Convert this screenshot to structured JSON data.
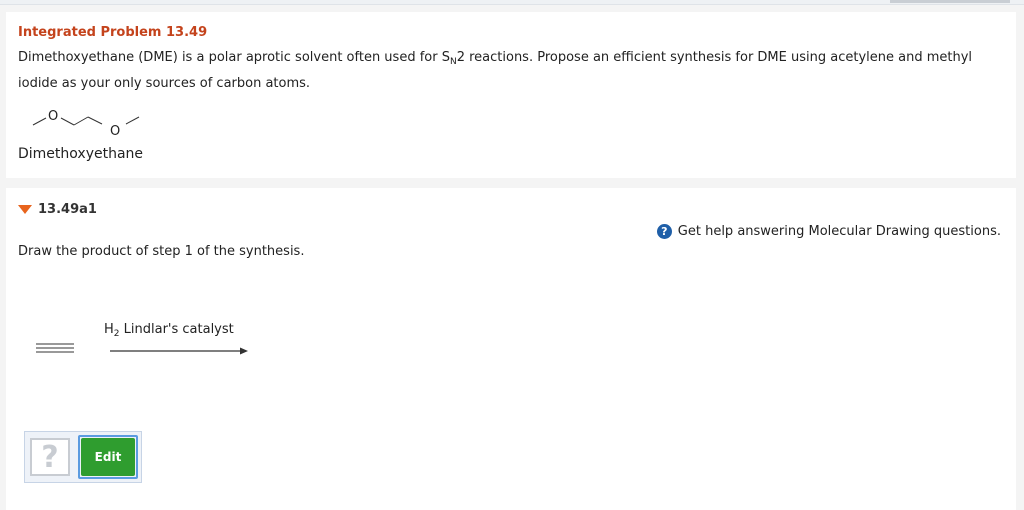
{
  "problem": {
    "title": "Integrated Problem 13.49",
    "text_before_sub": "Dimethoxyethane (DME) is a polar aprotic solvent often used for S",
    "subscript": "N",
    "text_after_sub": "2 reactions. Propose an efficient synthesis for DME using acetylene and methyl iodide as your only sources of carbon atoms.",
    "molecule_atoms": [
      "O",
      "O"
    ],
    "molecule_caption": "Dimethoxyethane"
  },
  "step": {
    "label": "13.49a1",
    "help_icon_glyph": "?",
    "help_text": "Get help answering Molecular Drawing questions.",
    "question": "Draw the product of step 1 of the synthesis.",
    "reagent_main": "H",
    "reagent_sub": "2",
    "reagent_rest": " Lindlar's catalyst",
    "answer_placeholder": "?",
    "edit_label": "Edit"
  },
  "colors": {
    "title": "#c4431c",
    "triangle": "#e8641d",
    "help_icon": "#1f5fa8",
    "edit_button": "#2f9d2f",
    "edit_outline": "#5b9be0"
  }
}
